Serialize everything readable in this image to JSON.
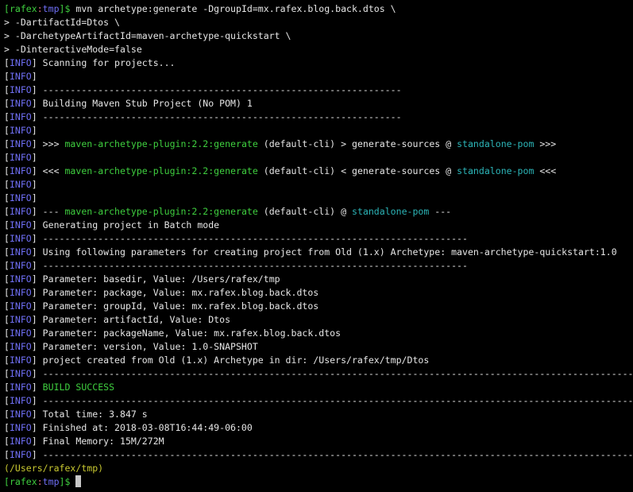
{
  "colors": {
    "w": "#e6e6e6",
    "b": "#6f6ff5",
    "g": "#3fcf3f",
    "c": "#2cb5b8",
    "y": "#c9c931",
    "p": "#e06a85"
  },
  "lines": [
    [
      {
        "t": "[rafex",
        "c": "g"
      },
      {
        "t": ":",
        "c": "p"
      },
      {
        "t": "tmp",
        "c": "b"
      },
      {
        "t": "]$ ",
        "c": "g"
      },
      {
        "t": "mvn archetype:generate -DgroupId=mx.rafex.blog.back.dtos \\",
        "c": "w"
      }
    ],
    [
      {
        "t": "> -DartifactId=Dtos \\",
        "c": "w"
      }
    ],
    [
      {
        "t": "> -DarchetypeArtifactId=maven-archetype-quickstart \\",
        "c": "w"
      }
    ],
    [
      {
        "t": "> -DinteractiveMode=false",
        "c": "w"
      }
    ],
    [
      {
        "t": "[",
        "c": "w"
      },
      {
        "t": "INFO",
        "c": "b"
      },
      {
        "t": "] Scanning for projects...",
        "c": "w"
      }
    ],
    [
      {
        "t": "[",
        "c": "w"
      },
      {
        "t": "INFO",
        "c": "b"
      },
      {
        "t": "]",
        "c": "w"
      }
    ],
    [
      {
        "t": "[",
        "c": "w"
      },
      {
        "t": "INFO",
        "c": "b"
      },
      {
        "t": "] -----------------------------------------------------------------",
        "c": "w"
      }
    ],
    [
      {
        "t": "[",
        "c": "w"
      },
      {
        "t": "INFO",
        "c": "b"
      },
      {
        "t": "] Building Maven Stub Project (No POM) 1",
        "c": "w"
      }
    ],
    [
      {
        "t": "[",
        "c": "w"
      },
      {
        "t": "INFO",
        "c": "b"
      },
      {
        "t": "] -----------------------------------------------------------------",
        "c": "w"
      }
    ],
    [
      {
        "t": "[",
        "c": "w"
      },
      {
        "t": "INFO",
        "c": "b"
      },
      {
        "t": "]",
        "c": "w"
      }
    ],
    [
      {
        "t": "[",
        "c": "w"
      },
      {
        "t": "INFO",
        "c": "b"
      },
      {
        "t": "] >>> ",
        "c": "w"
      },
      {
        "t": "maven-archetype-plugin:2.2:generate",
        "c": "g"
      },
      {
        "t": " (default-cli) > generate-sources @ ",
        "c": "w"
      },
      {
        "t": "standalone-pom",
        "c": "c"
      },
      {
        "t": " >>>",
        "c": "w"
      }
    ],
    [
      {
        "t": "[",
        "c": "w"
      },
      {
        "t": "INFO",
        "c": "b"
      },
      {
        "t": "]",
        "c": "w"
      }
    ],
    [
      {
        "t": "[",
        "c": "w"
      },
      {
        "t": "INFO",
        "c": "b"
      },
      {
        "t": "] <<< ",
        "c": "w"
      },
      {
        "t": "maven-archetype-plugin:2.2:generate",
        "c": "g"
      },
      {
        "t": " (default-cli) < generate-sources @ ",
        "c": "w"
      },
      {
        "t": "standalone-pom",
        "c": "c"
      },
      {
        "t": " <<<",
        "c": "w"
      }
    ],
    [
      {
        "t": "[",
        "c": "w"
      },
      {
        "t": "INFO",
        "c": "b"
      },
      {
        "t": "]",
        "c": "w"
      }
    ],
    [
      {
        "t": "[",
        "c": "w"
      },
      {
        "t": "INFO",
        "c": "b"
      },
      {
        "t": "]",
        "c": "w"
      }
    ],
    [
      {
        "t": "[",
        "c": "w"
      },
      {
        "t": "INFO",
        "c": "b"
      },
      {
        "t": "] --- ",
        "c": "w"
      },
      {
        "t": "maven-archetype-plugin:2.2:generate",
        "c": "g"
      },
      {
        "t": " (default-cli) @ ",
        "c": "w"
      },
      {
        "t": "standalone-pom",
        "c": "c"
      },
      {
        "t": " ---",
        "c": "w"
      }
    ],
    [
      {
        "t": "[",
        "c": "w"
      },
      {
        "t": "INFO",
        "c": "b"
      },
      {
        "t": "] Generating project in Batch mode",
        "c": "w"
      }
    ],
    [
      {
        "t": "[",
        "c": "w"
      },
      {
        "t": "INFO",
        "c": "b"
      },
      {
        "t": "] -----------------------------------------------------------------------------",
        "c": "w"
      }
    ],
    [
      {
        "t": "[",
        "c": "w"
      },
      {
        "t": "INFO",
        "c": "b"
      },
      {
        "t": "] Using following parameters for creating project from Old (1.x) Archetype: maven-archetype-quickstart:1.0",
        "c": "w"
      }
    ],
    [
      {
        "t": "[",
        "c": "w"
      },
      {
        "t": "INFO",
        "c": "b"
      },
      {
        "t": "] -----------------------------------------------------------------------------",
        "c": "w"
      }
    ],
    [
      {
        "t": "[",
        "c": "w"
      },
      {
        "t": "INFO",
        "c": "b"
      },
      {
        "t": "] Parameter: basedir, Value: /Users/rafex/tmp",
        "c": "w"
      }
    ],
    [
      {
        "t": "[",
        "c": "w"
      },
      {
        "t": "INFO",
        "c": "b"
      },
      {
        "t": "] Parameter: package, Value: mx.rafex.blog.back.dtos",
        "c": "w"
      }
    ],
    [
      {
        "t": "[",
        "c": "w"
      },
      {
        "t": "INFO",
        "c": "b"
      },
      {
        "t": "] Parameter: groupId, Value: mx.rafex.blog.back.dtos",
        "c": "w"
      }
    ],
    [
      {
        "t": "[",
        "c": "w"
      },
      {
        "t": "INFO",
        "c": "b"
      },
      {
        "t": "] Parameter: artifactId, Value: Dtos",
        "c": "w"
      }
    ],
    [
      {
        "t": "[",
        "c": "w"
      },
      {
        "t": "INFO",
        "c": "b"
      },
      {
        "t": "] Parameter: packageName, Value: mx.rafex.blog.back.dtos",
        "c": "w"
      }
    ],
    [
      {
        "t": "[",
        "c": "w"
      },
      {
        "t": "INFO",
        "c": "b"
      },
      {
        "t": "] Parameter: version, Value: 1.0-SNAPSHOT",
        "c": "w"
      }
    ],
    [
      {
        "t": "[",
        "c": "w"
      },
      {
        "t": "INFO",
        "c": "b"
      },
      {
        "t": "] project created from Old (1.x) Archetype in dir: /Users/rafex/tmp/Dtos",
        "c": "w"
      }
    ],
    [
      {
        "t": "[",
        "c": "w"
      },
      {
        "t": "INFO",
        "c": "b"
      },
      {
        "t": "] ------------------------------------------------------------------------------------------------------------",
        "c": "w"
      }
    ],
    [
      {
        "t": "[",
        "c": "w"
      },
      {
        "t": "INFO",
        "c": "b"
      },
      {
        "t": "] ",
        "c": "w"
      },
      {
        "t": "BUILD SUCCESS",
        "c": "g"
      }
    ],
    [
      {
        "t": "[",
        "c": "w"
      },
      {
        "t": "INFO",
        "c": "b"
      },
      {
        "t": "] ------------------------------------------------------------------------------------------------------------",
        "c": "w"
      }
    ],
    [
      {
        "t": "[",
        "c": "w"
      },
      {
        "t": "INFO",
        "c": "b"
      },
      {
        "t": "] Total time: 3.847 s",
        "c": "w"
      }
    ],
    [
      {
        "t": "[",
        "c": "w"
      },
      {
        "t": "INFO",
        "c": "b"
      },
      {
        "t": "] Finished at: 2018-03-08T16:44:49-06:00",
        "c": "w"
      }
    ],
    [
      {
        "t": "[",
        "c": "w"
      },
      {
        "t": "INFO",
        "c": "b"
      },
      {
        "t": "] Final Memory: 15M/272M",
        "c": "w"
      }
    ],
    [
      {
        "t": "[",
        "c": "w"
      },
      {
        "t": "INFO",
        "c": "b"
      },
      {
        "t": "] ------------------------------------------------------------------------------------------------------------",
        "c": "w"
      }
    ],
    [
      {
        "t": "(/Users/rafex/tmp)",
        "c": "y"
      }
    ],
    [
      {
        "t": "[rafex",
        "c": "g"
      },
      {
        "t": ":",
        "c": "p"
      },
      {
        "t": "tmp",
        "c": "b"
      },
      {
        "t": "]$ ",
        "c": "g"
      }
    ]
  ]
}
